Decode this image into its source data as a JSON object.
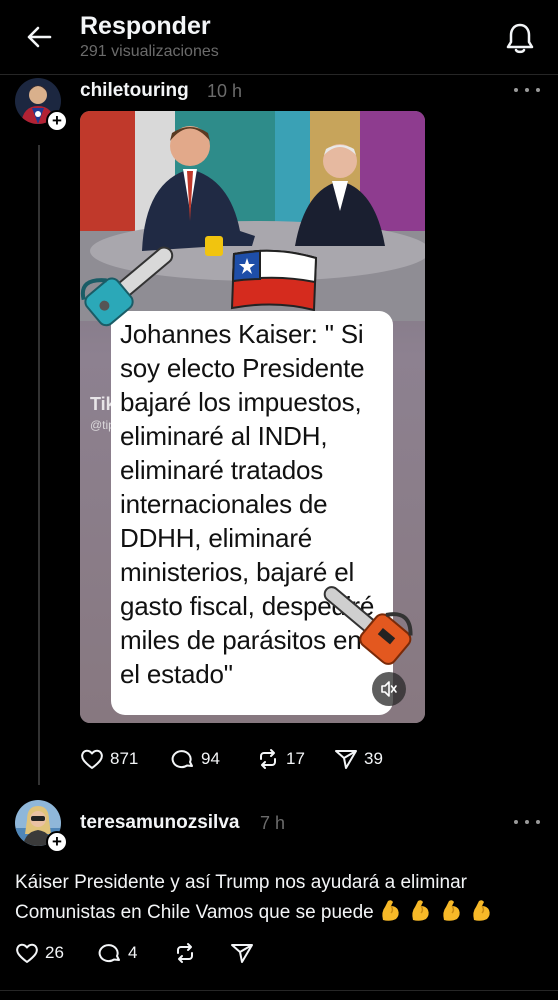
{
  "header": {
    "title": "Responder",
    "views": "291 visualizaciones"
  },
  "post": {
    "username": "chiletouring",
    "time": "10 h",
    "image": {
      "caption": "Johannes Kaiser: \" Si soy electo Presidente bajaré los impuestos, eliminaré al INDH, eliminaré tratados internacionales de DDHH, eliminaré ministerios, bajaré el gasto fiscal, despediré miles de parásitos en el estado\"",
      "watermark_logo": "TikTok",
      "watermark_user": "@tip..."
    },
    "actions": {
      "likes": "871",
      "comments": "94",
      "reposts": "17",
      "shares": "39"
    }
  },
  "reply": {
    "username": "teresamunozsilva",
    "time": "7 h",
    "text": "Káiser  Presidente y así Trump  nos ayudará a eliminar Comunistas en Chile Vamos que se puede",
    "emoji_count": 4,
    "actions": {
      "likes": "26",
      "comments": "4"
    }
  },
  "colors": {
    "background": "#000000",
    "text": "#f3f5f7",
    "muted": "#6b6b6b",
    "emoji": "#f7b928"
  }
}
